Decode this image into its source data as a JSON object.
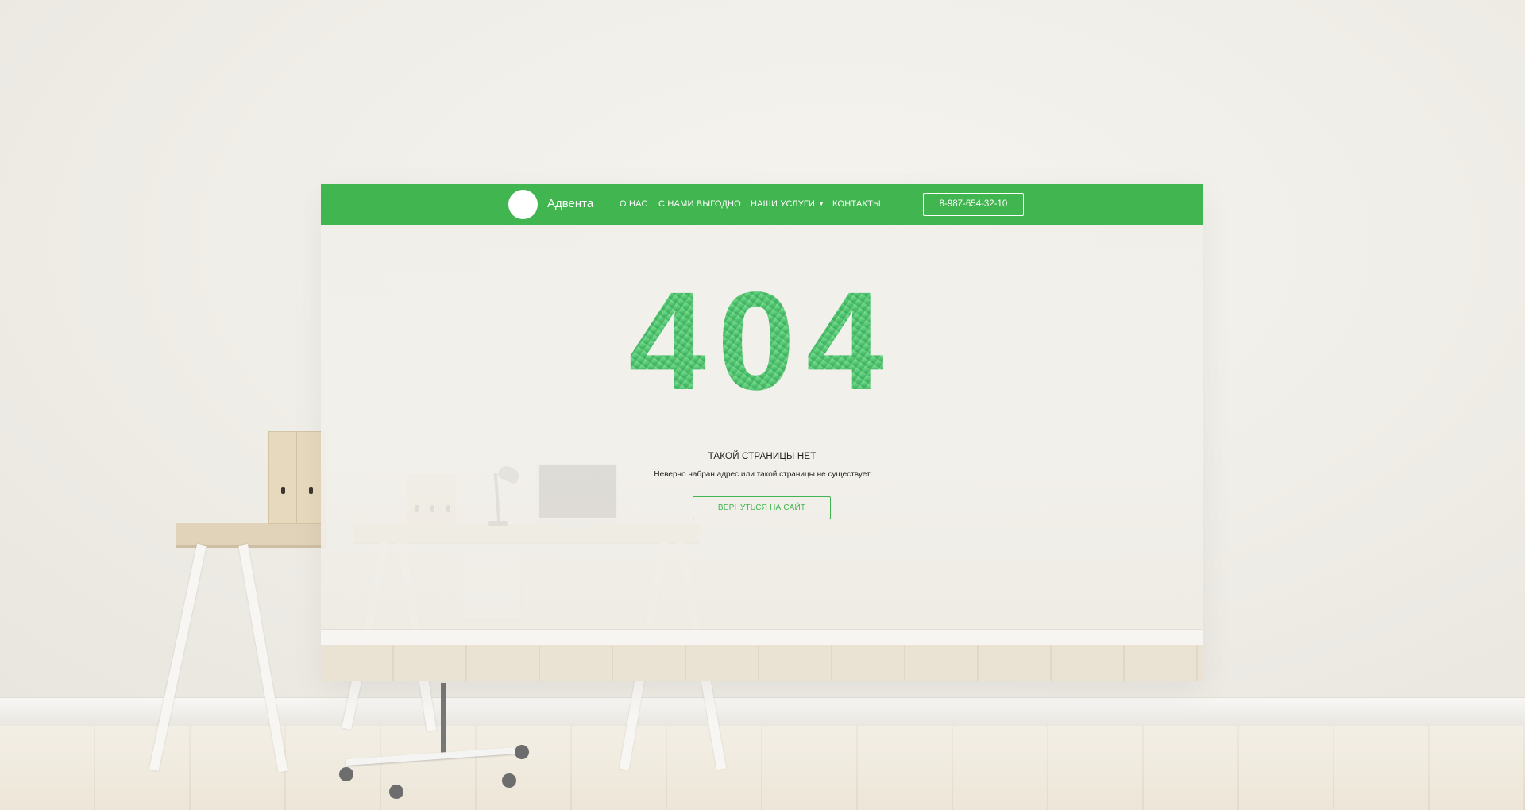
{
  "brand": {
    "name": "Адвента",
    "accent_color": "#41b54f"
  },
  "nav": {
    "items": [
      {
        "label": "О НАС"
      },
      {
        "label": "С НАМИ ВЫГОДНО"
      },
      {
        "label": "НАШИ УСЛУГИ",
        "icon": "caret-down-icon"
      },
      {
        "label": "КОНТАКТЫ"
      }
    ],
    "phone": "8-987-654-32-10"
  },
  "error": {
    "code": "404",
    "title": "ТАКОЙ СТРАНИЦЫ НЕТ",
    "description": "Неверно набран адрес или такой страницы не существует",
    "back_button": "ВЕРНУТЬСЯ НА САЙТ"
  }
}
